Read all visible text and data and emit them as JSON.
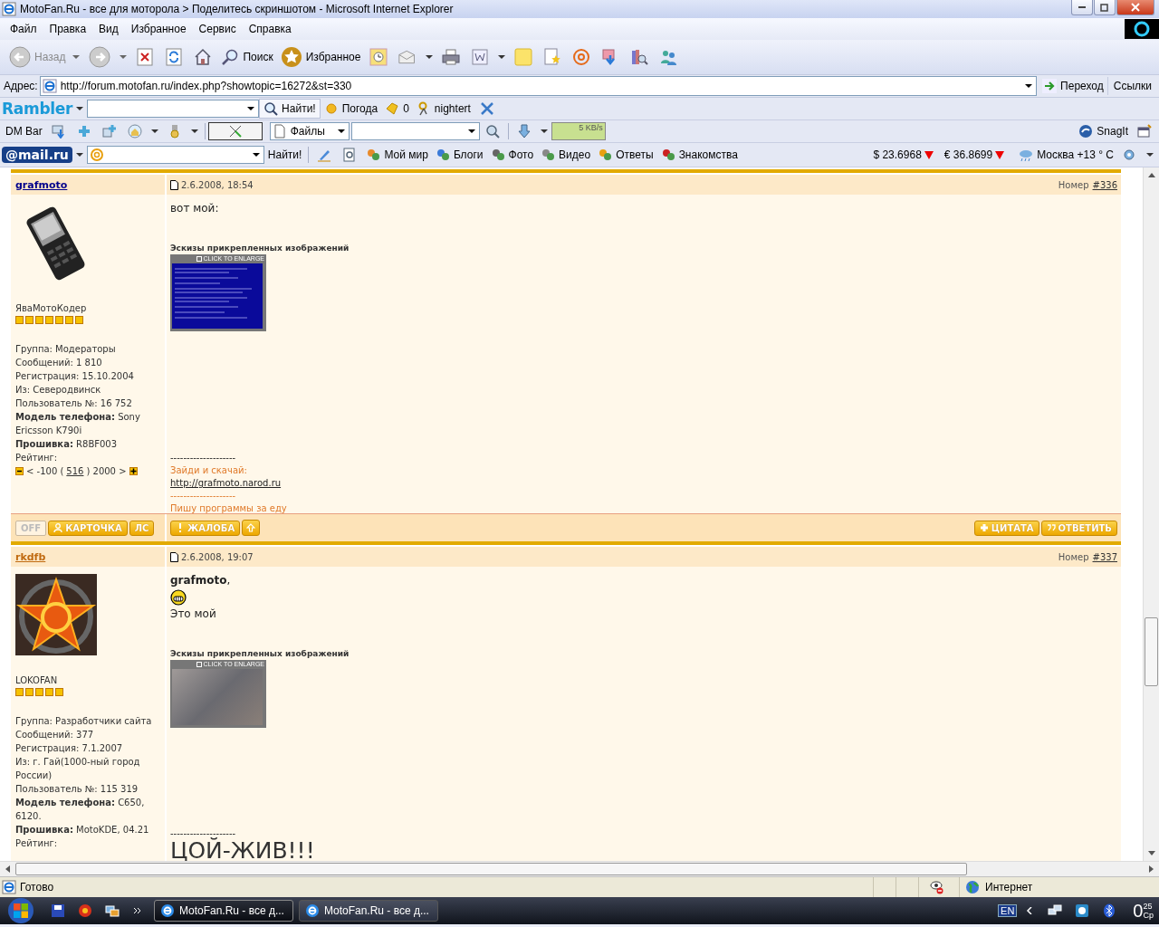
{
  "window": {
    "title": "MotoFan.Ru - все для моторола > Поделитесь скриншотом - Microsoft Internet Explorer"
  },
  "menu": [
    "Файл",
    "Правка",
    "Вид",
    "Избранное",
    "Сервис",
    "Справка"
  ],
  "toolbar": {
    "back": {
      "label": "Назад",
      "disabled": true
    },
    "search": "Поиск",
    "favorites": "Избранное"
  },
  "address": {
    "label": "Адрес:",
    "url": "http://forum.motofan.ru/index.php?showtopic=16272&st=330",
    "go": "Переход",
    "links": "Ссылки"
  },
  "rambler": {
    "logo": "Rambler",
    "search_button": "Найти!",
    "weather": "Погода",
    "count": "0",
    "user": "nightert"
  },
  "dmbar": {
    "label": "DM Bar",
    "files": "Файлы",
    "speed": "5 KB/s",
    "snagit": "SnagIt"
  },
  "mailbar": {
    "logo": "@mail.ru",
    "search_button": "Найти!",
    "links": [
      "Мой мир",
      "Блоги",
      "Фото",
      "Видео",
      "Ответы",
      "Знакомства"
    ],
    "rates": [
      {
        "text": "$ 23.6968",
        "falling": true
      },
      {
        "text": "€ 36.8699",
        "falling": true
      }
    ],
    "weather": "Москва +13 ° C"
  },
  "posts": [
    {
      "author": "grafmoto",
      "visited": false,
      "date": "2.6.2008, 18:54",
      "number_label": "Номер",
      "number": "#336",
      "avatar": {
        "kind": "phone"
      },
      "rank": "ЯваМотоКодер",
      "stars": 7,
      "info": [
        "Группа: Модераторы",
        "Сообщений: 1 810",
        "Регистрация: 15.10.2004",
        "Из: Северодвинск",
        "Пользователь №: 16 752",
        "**Модель телефона:** Sony Ericsson K790i",
        "**Прошивка:** R8BF003"
      ],
      "rating_label": "Рейтинг:",
      "rating": {
        "prefix": "< -100 (",
        "value": "516",
        "suffix": ") 2000 >"
      },
      "body": [
        {
          "kind": "text",
          "text": "вот мой:"
        },
        {
          "kind": "attachments",
          "title": "Эскизы прикрепленных изображений",
          "images": [
            {
              "caption": "CLICK TO ENLARGE",
              "kind": "screen"
            }
          ]
        },
        {
          "kind": "divider",
          "text": "--------------------"
        },
        {
          "kind": "signature",
          "text": "Зайди и скачай:"
        },
        {
          "kind": "link",
          "text": "http://grafmoto.narod.ru"
        },
        {
          "kind": "signature",
          "text": "--------------------"
        },
        {
          "kind": "signature",
          "text": "Пишу программы за еду"
        }
      ],
      "buttons": {
        "status": "OFF",
        "profile": "КАРТОЧКА",
        "pm": "ЛС",
        "report": "ЖАЛОБА",
        "quote": "ЦИТАТА",
        "reply": "ОТВЕТИТЬ"
      }
    },
    {
      "author": "rkdfb",
      "visited": true,
      "date": "2.6.2008, 19:07",
      "number_label": "Номер",
      "number": "#337",
      "avatar": {
        "kind": "emblem"
      },
      "rank": "LOKOFAN",
      "stars": 5,
      "info": [
        "Группа: Разработчики сайта",
        "Сообщений: 377",
        "Регистрация: 7.1.2007",
        "Из: г. Гай(1000-ный город России)",
        "Пользователь №: 115 319",
        "**Модель телефона:** C650, 6120.",
        "**Прошивка:** MotoKDE, 04.21"
      ],
      "rating_label": "Рейтинг:",
      "body": [
        {
          "kind": "mention",
          "text": "**grafmoto**,"
        },
        {
          "kind": "smiley"
        },
        {
          "kind": "text",
          "text": "Это мой"
        },
        {
          "kind": "attachments",
          "title": "Эскизы прикрепленных изображений",
          "images": [
            {
              "caption": "CLICK TO ENLARGE",
              "kind": "photo"
            }
          ]
        },
        {
          "kind": "divider",
          "text": "--------------------"
        },
        {
          "kind": "big",
          "text": "ЦОЙ-ЖИВ!!!"
        }
      ]
    }
  ],
  "status_bar": {
    "text": "Готово",
    "zone": "Интернет"
  },
  "taskbar": {
    "tasks": [
      {
        "label": "MotoFan.Ru - все д...",
        "selected": true
      },
      {
        "label": "MotoFan.Ru - все д...",
        "selected": false
      }
    ],
    "language": "EN",
    "clock": {
      "hour": "0",
      "minute": "25",
      "day": "Ср"
    }
  }
}
